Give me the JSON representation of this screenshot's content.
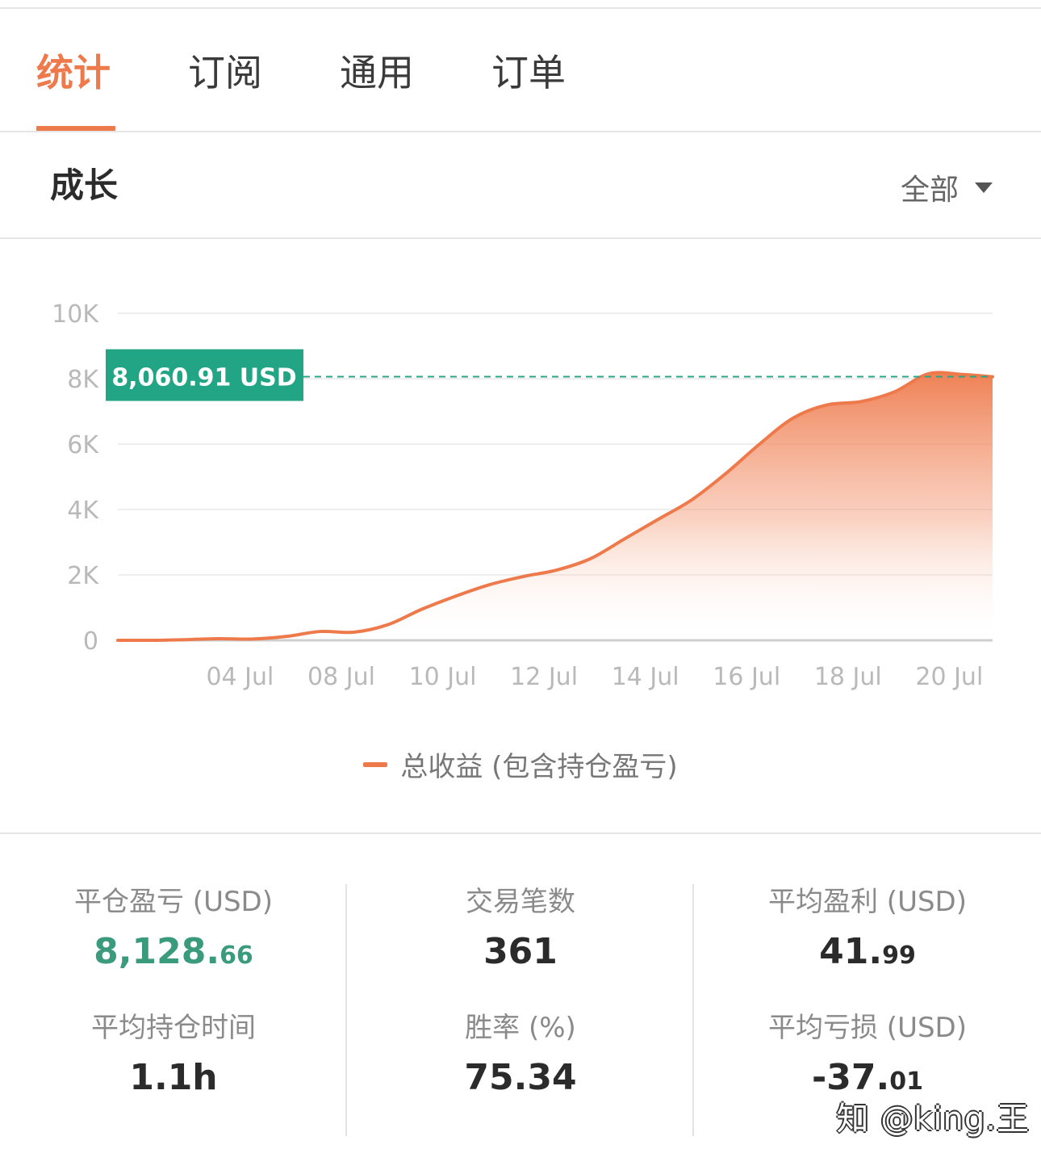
{
  "tabs": [
    {
      "label": "统计",
      "active": true
    },
    {
      "label": "订阅",
      "active": false
    },
    {
      "label": "通用",
      "active": false
    },
    {
      "label": "订单",
      "active": false
    }
  ],
  "section": {
    "title": "成长",
    "range_label": "全部"
  },
  "chart_data": {
    "type": "area",
    "y_tick_labels": [
      "0",
      "2K",
      "4K",
      "6K",
      "8K",
      "10K"
    ],
    "ylim": [
      0,
      10000
    ],
    "x_tick_labels": [
      "04 Jul",
      "08 Jul",
      "10 Jul",
      "12 Jul",
      "14 Jul",
      "16 Jul",
      "18 Jul",
      "20 Jul"
    ],
    "grid": true,
    "current_value_label": "8,060.91 USD",
    "current_value": 8060.91,
    "series": [
      {
        "name": "总收益 (包含持仓盈亏)",
        "color": "#ee7a4c",
        "points": [
          {
            "x": 0.0,
            "y": 0
          },
          {
            "x": 0.5,
            "y": 0
          },
          {
            "x": 1.0,
            "y": 20
          },
          {
            "x": 1.5,
            "y": 50
          },
          {
            "x": 2.0,
            "y": 40
          },
          {
            "x": 2.5,
            "y": 120
          },
          {
            "x": 3.0,
            "y": 270
          },
          {
            "x": 3.5,
            "y": 250
          },
          {
            "x": 4.0,
            "y": 480
          },
          {
            "x": 4.5,
            "y": 950
          },
          {
            "x": 5.0,
            "y": 1350
          },
          {
            "x": 5.5,
            "y": 1700
          },
          {
            "x": 6.0,
            "y": 1950
          },
          {
            "x": 6.5,
            "y": 2150
          },
          {
            "x": 7.0,
            "y": 2500
          },
          {
            "x": 7.5,
            "y": 3100
          },
          {
            "x": 8.0,
            "y": 3700
          },
          {
            "x": 8.5,
            "y": 4300
          },
          {
            "x": 9.0,
            "y": 5100
          },
          {
            "x": 9.5,
            "y": 6000
          },
          {
            "x": 10.0,
            "y": 6800
          },
          {
            "x": 10.5,
            "y": 7200
          },
          {
            "x": 11.0,
            "y": 7300
          },
          {
            "x": 11.5,
            "y": 7600
          },
          {
            "x": 12.0,
            "y": 8150
          },
          {
            "x": 12.5,
            "y": 8130
          },
          {
            "x": 12.95,
            "y": 8060
          }
        ],
        "tick_x_positions": [
          2.0,
          3.5,
          5.0,
          6.5,
          8.0,
          9.5,
          11.0,
          12.5
        ]
      }
    ]
  },
  "legend": {
    "label": "总收益 (包含持仓盈亏)"
  },
  "stats": {
    "closed_pnl": {
      "label": "平仓盈亏 (USD)",
      "int": "8,128.",
      "dec": "66"
    },
    "trade_count": {
      "label": "交易笔数",
      "value": "361"
    },
    "avg_profit": {
      "label": "平均盈利 (USD)",
      "int": "41.",
      "dec": "99"
    },
    "avg_hold": {
      "label": "平均持仓时间",
      "value": "1.1h"
    },
    "win_rate": {
      "label": "胜率 (%)",
      "value": "75.34"
    },
    "avg_loss": {
      "label": "平均亏损 (USD)",
      "int": "-37.",
      "dec": "01"
    }
  },
  "watermark": "知 @king.王"
}
